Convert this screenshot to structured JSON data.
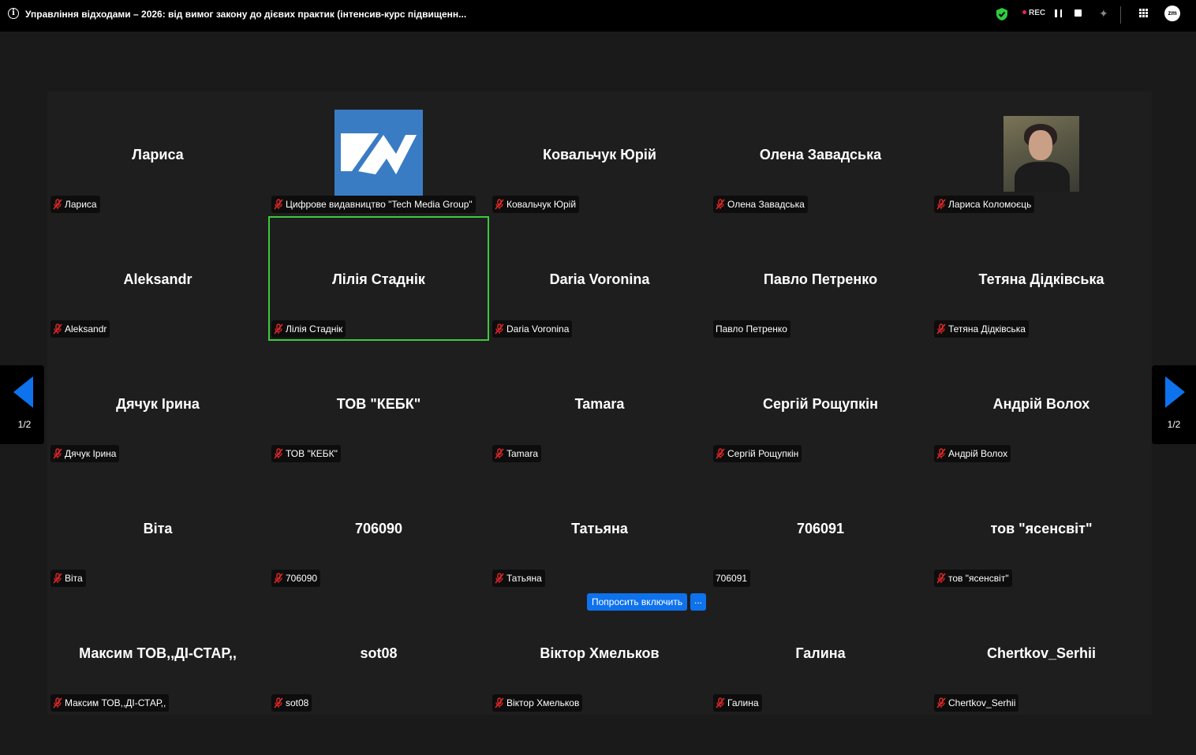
{
  "meeting": {
    "title": "Управління відходами – 2026: від вимог закону до дієвих практик (інтенсив-курс підвищенн...",
    "rec_label": "REC"
  },
  "icons": {
    "info": "info-icon",
    "shield": "shield-check-icon",
    "pause": "pause-icon",
    "stop": "stop-icon",
    "ai": "sparkle-icon",
    "apps": "grid-icon",
    "account": "zm-avatar-icon",
    "mic": "mic-off-icon"
  },
  "colors": {
    "accent": "#0e72ed",
    "active_speaker": "#3ec93e",
    "mic_off": "#e02828",
    "shield": "#2ecc40"
  },
  "participants": [
    {
      "name": "Лариса",
      "label": "Лариса",
      "muted": true
    },
    {
      "name": "",
      "label": "Цифрове видавництво \"Tech Media Group\"",
      "muted": true,
      "image": "logo"
    },
    {
      "name": "Ковальчук Юрій",
      "label": "Ковальчук Юрій",
      "muted": true
    },
    {
      "name": "Олена Завадська",
      "label": "Олена Завадська",
      "muted": true
    },
    {
      "name": "",
      "label": "Лариса Коломоєць",
      "muted": true,
      "image": "photo"
    },
    {
      "name": "Aleksandr",
      "label": "Aleksandr",
      "muted": true
    },
    {
      "name": "Лілія Стаднік",
      "label": "Лілія Стаднік",
      "muted": true,
      "active": true
    },
    {
      "name": "Daria Voronina",
      "label": "Daria Voronina",
      "muted": true
    },
    {
      "name": "Павло Петренко",
      "label": "Павло Петренко",
      "muted": false
    },
    {
      "name": "Тетяна Дідківська",
      "label": "Тетяна Дідківська",
      "muted": true
    },
    {
      "name": "Дячук Ірина",
      "label": "Дячук Ірина",
      "muted": true
    },
    {
      "name": "ТОВ \"КЕБК\"",
      "label": "ТОВ \"КЕБК\"",
      "muted": true
    },
    {
      "name": "Tamara",
      "label": "Tamara",
      "muted": true
    },
    {
      "name": "Сергій Рощупкін",
      "label": "Сергій Рощупкін",
      "muted": true
    },
    {
      "name": "Андрій Волох",
      "label": "Андрій Волох",
      "muted": true
    },
    {
      "name": "Віта",
      "label": "Віта",
      "muted": true
    },
    {
      "name": "706090",
      "label": "706090",
      "muted": true
    },
    {
      "name": "Татьяна",
      "label": "Татьяна",
      "muted": true
    },
    {
      "name": "706091",
      "label": "706091",
      "muted": false
    },
    {
      "name": "тов \"ясенсвіт\"",
      "label": "тов \"ясенсвіт\"",
      "muted": true
    },
    {
      "name": "Максим ТОВ,,ДІ-СТАР,,",
      "label": "Максим ТОВ,,ДІ-СТАР,,",
      "muted": true
    },
    {
      "name": "sot08",
      "label": "sot08",
      "muted": true
    },
    {
      "name": "Віктор Хмельков",
      "label": "Віктор Хмельков",
      "muted": true
    },
    {
      "name": "Галина",
      "label": "Галина",
      "muted": true
    },
    {
      "name": "Chertkov_Serhii",
      "label": "Chertkov_Serhii",
      "muted": true
    }
  ],
  "hover_actions": {
    "ask_unmute": "Попросить включить",
    "more": "..."
  },
  "pagination": {
    "left": "1/2",
    "right": "1/2"
  }
}
